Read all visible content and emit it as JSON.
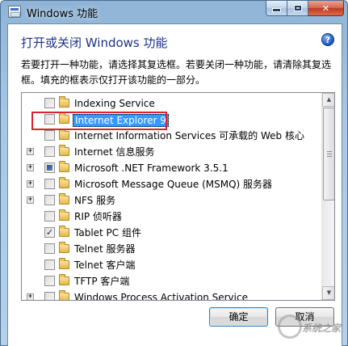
{
  "window": {
    "title": "Windows 功能",
    "minimize_icon": "minimize-icon",
    "maximize_icon": "maximize-icon",
    "close_icon": "close-icon",
    "close_glyph": "✕"
  },
  "header": {
    "heading": "打开或关闭 Windows 功能",
    "help_glyph": "?",
    "description": "若要打开一种功能，请选择其复选框。若要关闭一种功能，请清除其复选框。填充的框表示仅打开该功能的一部分。"
  },
  "features": [
    {
      "label": "Indexing Service",
      "expandable": false,
      "checked": "unchecked",
      "selected": false
    },
    {
      "label": "Internet Explorer 9",
      "expandable": false,
      "checked": "unchecked",
      "selected": true
    },
    {
      "label": "Internet Information Services 可承载的 Web 核心",
      "expandable": false,
      "checked": "unchecked",
      "selected": false
    },
    {
      "label": "Internet 信息服务",
      "expandable": true,
      "checked": "unchecked",
      "selected": false
    },
    {
      "label": "Microsoft .NET Framework 3.5.1",
      "expandable": true,
      "checked": "partial",
      "selected": false
    },
    {
      "label": "Microsoft Message Queue (MSMQ) 服务器",
      "expandable": true,
      "checked": "unchecked",
      "selected": false
    },
    {
      "label": "NFS 服务",
      "expandable": true,
      "checked": "unchecked",
      "selected": false
    },
    {
      "label": "RIP 侦听器",
      "expandable": false,
      "checked": "unchecked",
      "selected": false
    },
    {
      "label": "Tablet PC 组件",
      "expandable": false,
      "checked": "checked",
      "selected": false
    },
    {
      "label": "Telnet 服务器",
      "expandable": false,
      "checked": "unchecked",
      "selected": false
    },
    {
      "label": "Telnet 客户端",
      "expandable": false,
      "checked": "unchecked",
      "selected": false
    },
    {
      "label": "TFTP 客户端",
      "expandable": false,
      "checked": "unchecked",
      "selected": false
    },
    {
      "label": "Windows Process Activation Service",
      "expandable": true,
      "checked": "unchecked",
      "selected": false
    }
  ],
  "tree_glyphs": {
    "expand": "+",
    "check": "✓",
    "scroll_up": "▲",
    "scroll_down": "▼"
  },
  "buttons": {
    "ok_label": "确定",
    "cancel_label": "取消"
  },
  "watermark": {
    "text": "系统之家"
  },
  "colors": {
    "heading": "#1e3287",
    "selection": "#3399ff",
    "highlight_box": "#e0202e"
  }
}
